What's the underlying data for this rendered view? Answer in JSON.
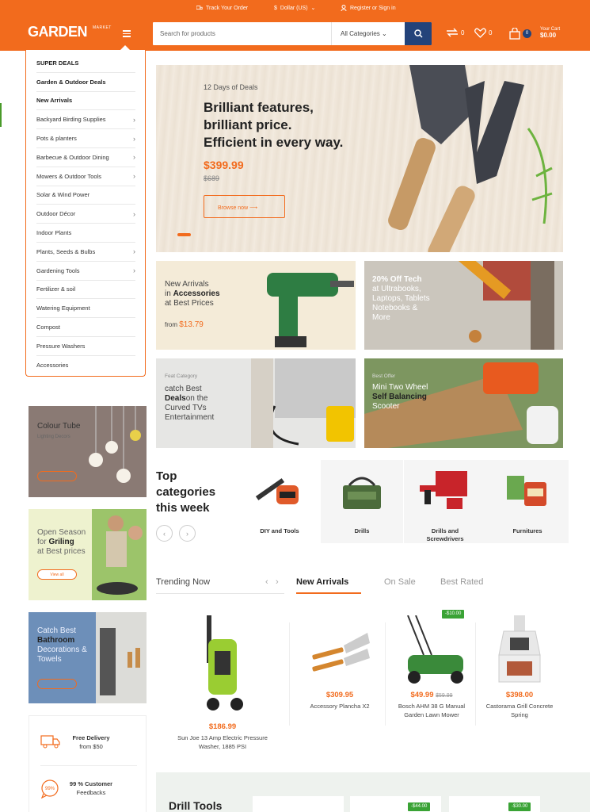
{
  "header": {
    "track_order": "Track Your Order",
    "currency": "Dollar (US)",
    "register": "Register or Sign in",
    "logo": "GARDEN",
    "logo_sub": "MARKET",
    "search_placeholder": "Search for products",
    "search_category": "All Categories",
    "compare_count": "0",
    "wishlist_count": "0",
    "cart_count": "0",
    "cart_label": "Your Cart",
    "cart_total": "$0.00"
  },
  "menu": {
    "items": [
      {
        "label": "SUPER DEALS",
        "bold": true,
        "arrow": false
      },
      {
        "label": "Garden & Outdoor Deals",
        "bold": true,
        "arrow": false
      },
      {
        "label": "New Arrivals",
        "bold": true,
        "arrow": false
      },
      {
        "label": "Backyard Birding Supplies",
        "bold": false,
        "arrow": true
      },
      {
        "label": "Pots & planters",
        "bold": false,
        "arrow": true
      },
      {
        "label": "Barbecue & Outdoor Dining",
        "bold": false,
        "arrow": true
      },
      {
        "label": "Mowers & Outdoor Tools",
        "bold": false,
        "arrow": true
      },
      {
        "label": "Solar & Wind Power",
        "bold": false,
        "arrow": false
      },
      {
        "label": "Outdoor Décor",
        "bold": false,
        "arrow": true
      },
      {
        "label": "Indoor Plants",
        "bold": false,
        "arrow": false
      },
      {
        "label": "Plants, Seeds & Bulbs",
        "bold": false,
        "arrow": true
      },
      {
        "label": "Gardening Tools",
        "bold": false,
        "arrow": true
      },
      {
        "label": "Fertilizer & soil",
        "bold": false,
        "arrow": false
      },
      {
        "label": "Watering Equipment",
        "bold": false,
        "arrow": false
      },
      {
        "label": "Compost",
        "bold": false,
        "arrow": false
      },
      {
        "label": "Pressure Washers",
        "bold": false,
        "arrow": false
      },
      {
        "label": "Accessories",
        "bold": false,
        "arrow": false
      }
    ]
  },
  "hero": {
    "eyebrow": "12 Days of Deals",
    "line1": "Brilliant features,",
    "line2": "brilliant price.",
    "line3": "Efficient in every way.",
    "price": "$399.99",
    "old_price": "$689",
    "button": "Browse now"
  },
  "tiles": {
    "t1_a": "New Arrivals",
    "t1_b": "in",
    "t1_c": "Accessories",
    "t1_d": "at Best Prices",
    "t1_from": "from",
    "t1_price": "$13.79",
    "t2_a": "20% Off Tech",
    "t2_b": "at Ultrabooks,",
    "t2_c": "Laptops, Tablets",
    "t2_d": "Notebooks &",
    "t2_e": "More",
    "t3_eyebrow": "Feat Category",
    "t3_a": "catch Best",
    "t3_b": "Deals",
    "t3_c": "on the",
    "t3_d": "Curved TVs",
    "t3_e": "Entertainment",
    "t4_eyebrow": "Best Offer",
    "t4_a": "Mini Two Wheel",
    "t4_b": "Self Balancing",
    "t4_c": "Scooter"
  },
  "side_banners": {
    "b1_a": "Colour Tube",
    "b1_b": "Lighting Decors",
    "b2_a": "Open Season",
    "b2_b": "for",
    "b2_c": "Griling",
    "b2_d": "at Best prices",
    "b2_btn": "View all",
    "b3_a": "Catch Best",
    "b3_b": "Bathroom",
    "b3_c": "Decorations &",
    "b3_d": "Towels"
  },
  "features": {
    "f1_a": "Free Delivery",
    "f1_b": "from $50",
    "f2_a": "99 % Customer",
    "f2_b": "Feedbacks",
    "f2_icon": "99%"
  },
  "top_categories": {
    "title_1": "Top",
    "title_2": "categories",
    "title_3": "this week",
    "c1": "DIY and Tools",
    "c2": "Drills",
    "c3_a": "Drills and",
    "c3_b": "Screwdrivers",
    "c4": "Furnitures"
  },
  "tabs": {
    "trending": "Trending Now",
    "new_arrivals": "New Arrivals",
    "on_sale": "On Sale",
    "best_rated": "Best Rated"
  },
  "products": {
    "p1_price": "$186.99",
    "p1_name_a": "Sun Joe 13 Amp Electric Pressure",
    "p1_name_b": "Washer, 1885 PSI",
    "p2_price": "$309.95",
    "p2_name": "Accessory Plancha X2",
    "p3_badge": "-$10.00",
    "p3_price": "$49.99",
    "p3_old": "$59.99",
    "p3_name_a": "Bosch AHM 38 G Manual",
    "p3_name_b": "Garden Lawn Mower",
    "p4_price": "$398.00",
    "p4_name_a": "Castorama Grill Concrete",
    "p4_name_b": "Spring"
  },
  "drill": {
    "title": "Drill Tools",
    "badge1": "-$44.00",
    "badge2": "-$30.00"
  },
  "colors": {
    "brand": "#f26b1d",
    "navy": "#23437a",
    "green": "#3aa335"
  }
}
